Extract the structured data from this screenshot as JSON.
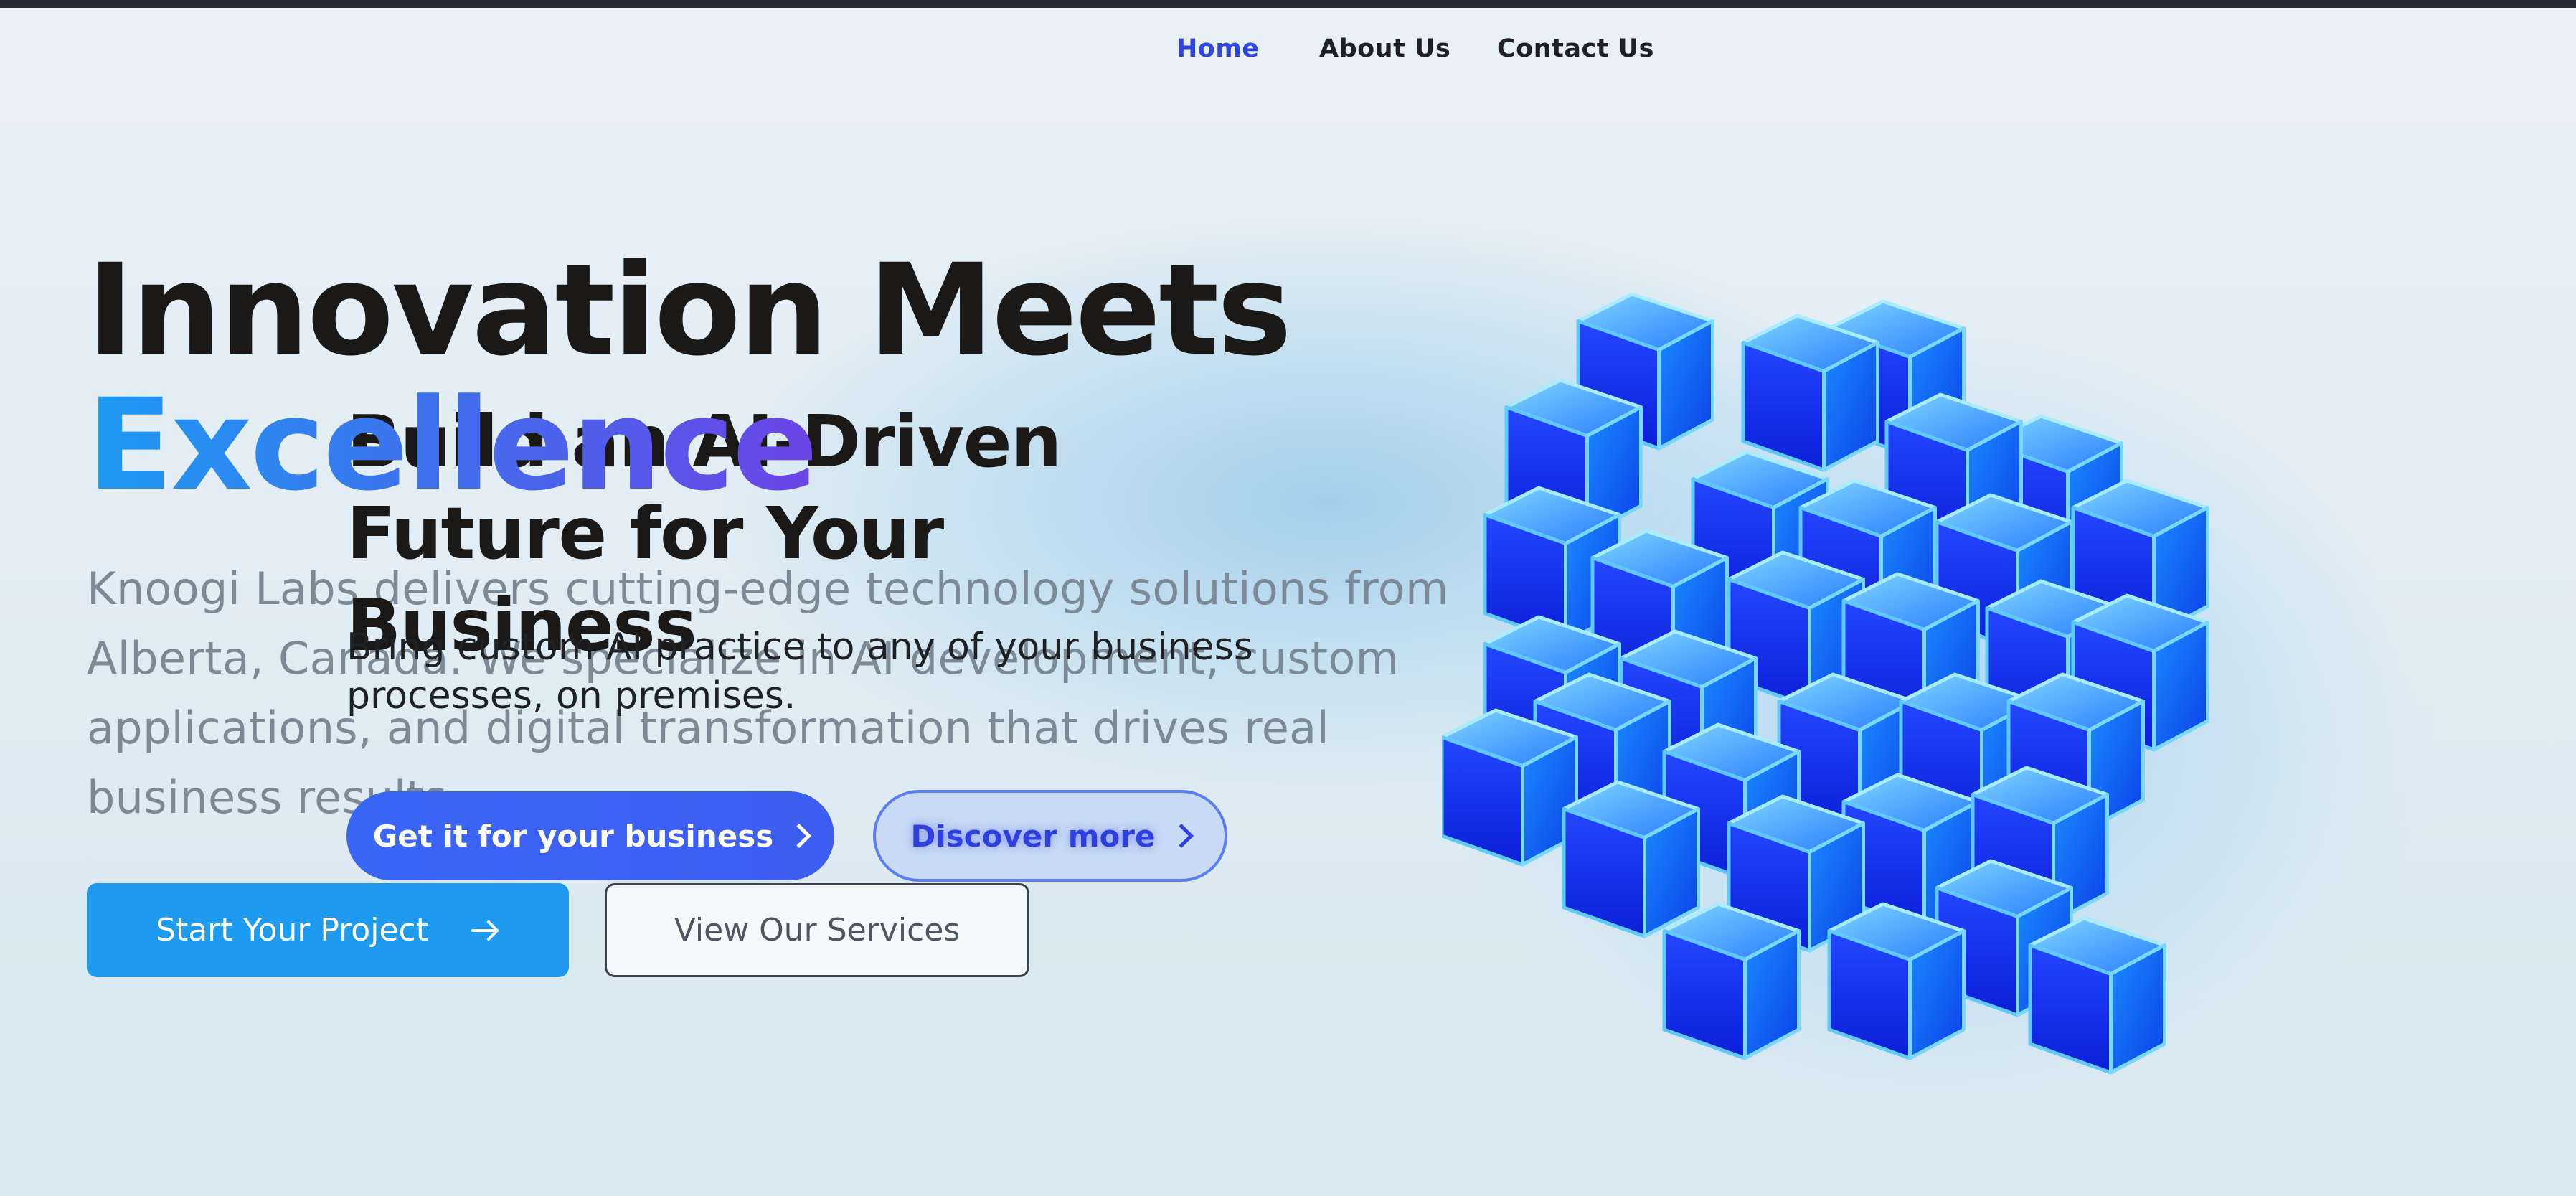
{
  "nav": {
    "items": [
      {
        "label": "Home",
        "active": true
      },
      {
        "label": "About Us",
        "active": false
      },
      {
        "label": "Contact Us",
        "active": false
      }
    ]
  },
  "hero": {
    "title_line1": "Innovation Meets",
    "title_accent": "Excellence",
    "description": "Knoogi Labs delivers cutting-edge technology solutions from Alberta, Canada. We specialize in AI development, custom applications, and digital transformation that drives real business results.",
    "primary_button": "Start Your Project",
    "secondary_button": "View Our Services"
  },
  "hero_overlay": {
    "title": "Build an AI-Driven Future for Your Business",
    "description": "Bring custom AI practice to any of your business processes, on premises.",
    "get_button": "Get it for your business",
    "discover_button": "Discover more"
  },
  "colors": {
    "accent_blue": "#1e9bee",
    "nav_active": "#2e46df",
    "gradient_start": "#1d9cf3",
    "gradient_end": "#6b44e6",
    "cube_blue": "#1a3cff"
  },
  "icons": {
    "primary_button_icon": "arrow-right-icon",
    "get_button_icon": "chevron-right-icon",
    "discover_button_icon": "chevron-right-icon"
  }
}
